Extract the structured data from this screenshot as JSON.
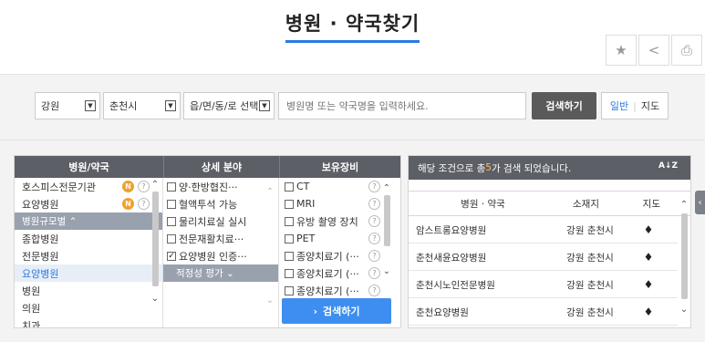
{
  "page": {
    "title": "병원 · 약국찾기"
  },
  "toolbar": {
    "favorite": "★",
    "share": "<",
    "print": "⎙"
  },
  "search": {
    "province": "강원",
    "city": "춘천시",
    "district": "읍/면/동/로 선택",
    "placeholder": "병원명 또는 약국명을 입력하세요.",
    "button": "검색하기",
    "view_normal": "일반",
    "view_map": "지도"
  },
  "filters": {
    "headers": [
      "병원/약국",
      "상세 분야",
      "보유장비"
    ],
    "types": [
      {
        "label": "호스피스전문기관",
        "badge": "N",
        "help": "?"
      },
      {
        "label": "요양병원",
        "badge": "N",
        "help": "?"
      },
      {
        "label": "병원규모별 ⌃",
        "group": true
      },
      {
        "label": "종합병원"
      },
      {
        "label": "전문병원"
      },
      {
        "label": "요양병원",
        "selected": true
      },
      {
        "label": "병원"
      },
      {
        "label": "의원"
      },
      {
        "label": "치과"
      }
    ],
    "fields": [
      {
        "label": "양·한방협진···",
        "checked": false
      },
      {
        "label": "혈액투석 가능",
        "checked": false
      },
      {
        "label": "물리치료실 실시",
        "checked": false
      },
      {
        "label": "전문재활치료···",
        "checked": false
      },
      {
        "label": "요양병원 인증···",
        "checked": true
      },
      {
        "label": "적정성 평가 ⌄",
        "group": true
      }
    ],
    "equipment": [
      {
        "label": "CT",
        "help": "?"
      },
      {
        "label": "MRI",
        "help": "?"
      },
      {
        "label": "유방 촬영 장치",
        "help": "?"
      },
      {
        "label": "PET",
        "help": "?"
      },
      {
        "label": "종양치료기 (···",
        "help": "?"
      },
      {
        "label": "종양치료기 (···",
        "help": "?"
      },
      {
        "label": "종양치료기 (···",
        "help": "?"
      }
    ],
    "search_button": "검색하기"
  },
  "results": {
    "summary_prefix": "해당 조건으로 총 ",
    "count": "5",
    "summary_suffix": "가 검색 되었습니다.",
    "sort_label": "A↓Z",
    "columns": [
      "병원 · 약국",
      "소재지",
      "지도"
    ],
    "rows": [
      {
        "name": "암스트롱요양병원",
        "location": "강원 춘천시"
      },
      {
        "name": "춘천새윤요양병원",
        "location": "강원 춘천시"
      },
      {
        "name": "춘천시노인전문병원",
        "location": "강원 춘천시"
      },
      {
        "name": "춘천요양병원",
        "location": "강원 춘천시"
      }
    ]
  },
  "colors": {
    "accent": "#2a7ae2",
    "header": "#5c5f66",
    "badge": "#f0a030",
    "button": "#3d8ef0"
  }
}
